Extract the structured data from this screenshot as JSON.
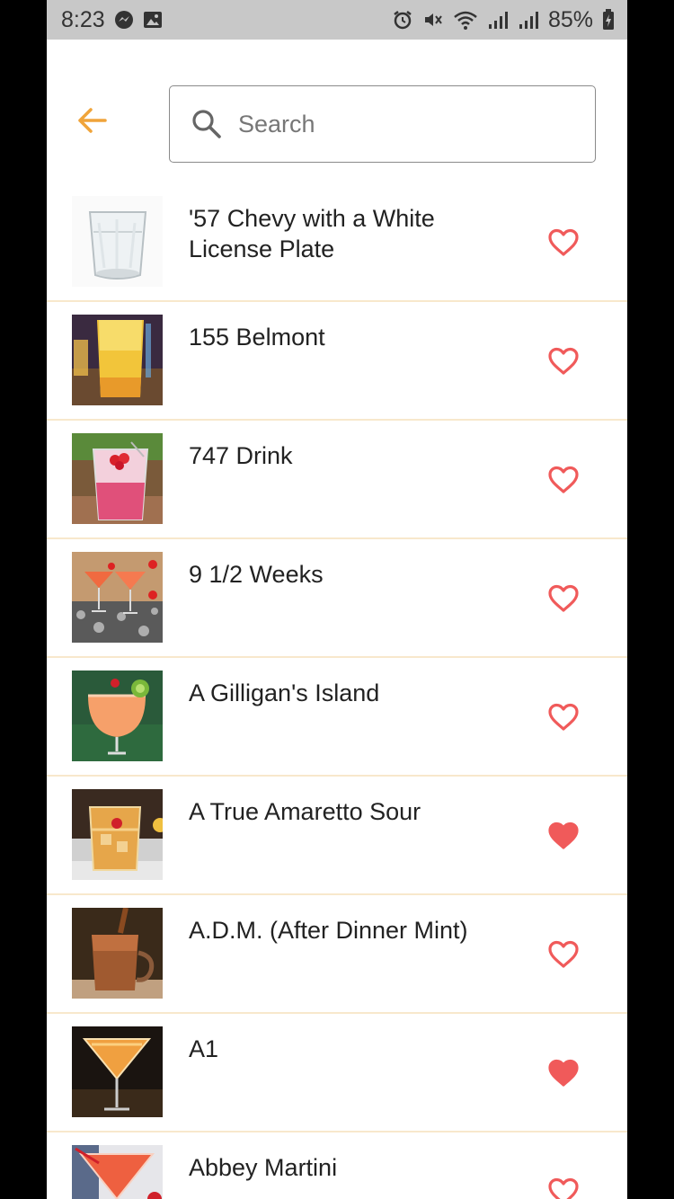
{
  "status_bar": {
    "time": "8:23",
    "battery": "85%",
    "icons_left": [
      "messenger-icon",
      "image-icon"
    ],
    "icons_right": [
      "alarm-icon",
      "mute-icon",
      "wifi-icon",
      "signal-icon",
      "signal-icon",
      "battery-icon"
    ]
  },
  "header": {
    "back_icon": "arrow-left-icon",
    "search_placeholder": "Search",
    "search_value": ""
  },
  "colors": {
    "accent": "#f0a43a",
    "heart": "#f05a5a",
    "divider": "#f8e8cc",
    "status_bar_bg": "#c8c8c8"
  },
  "drinks": [
    {
      "name": "'57 Chevy with a White License Plate",
      "favorite": false,
      "thumb": "glass-clear"
    },
    {
      "name": "155 Belmont",
      "favorite": false,
      "thumb": "tall-yellow"
    },
    {
      "name": "747 Drink",
      "favorite": false,
      "thumb": "pink-rocks"
    },
    {
      "name": "9 1/2 Weeks",
      "favorite": false,
      "thumb": "orange-cocktails"
    },
    {
      "name": "A Gilligan's Island",
      "favorite": false,
      "thumb": "peach-hurricane"
    },
    {
      "name": "A True Amaretto Sour",
      "favorite": true,
      "thumb": "amber-rocks"
    },
    {
      "name": "A.D.M. (After Dinner Mint)",
      "favorite": false,
      "thumb": "chocolate-mug"
    },
    {
      "name": "A1",
      "favorite": true,
      "thumb": "orange-martini"
    },
    {
      "name": "Abbey Martini",
      "favorite": false,
      "thumb": "red-martini"
    }
  ]
}
